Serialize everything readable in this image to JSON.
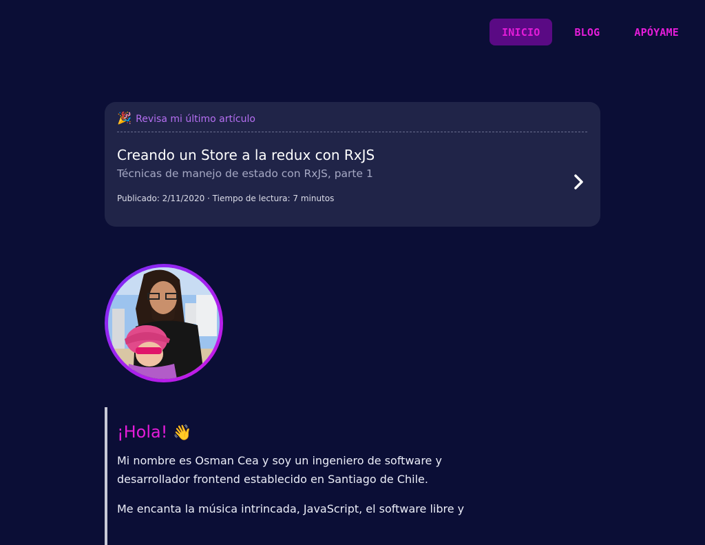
{
  "nav": {
    "items": [
      {
        "label": "INICIO",
        "active": true
      },
      {
        "label": "BLOG",
        "active": false
      },
      {
        "label": "APÓYAME",
        "active": false
      }
    ]
  },
  "latest_post": {
    "heading": "Revisa mi último artículo",
    "title": "Creando un Store a la redux con RxJS",
    "subtitle": "Técnicas de manejo de estado con RxJS, parte 1",
    "meta": "Publicado: 2/11/2020 · Tiempo de lectura: 7 minutos"
  },
  "intro": {
    "greeting": "¡Hola!",
    "wave_emoji": "👋",
    "paragraphs": [
      "Mi nombre es Osman Cea y soy un ingeniero de software y desarrollador frontend establecido en Santiago de Chile.",
      "Me encanta la música intrincada, JavaScript, el software libre y"
    ]
  },
  "colors": {
    "background": "#0b0e36",
    "accent": "#e41cd9",
    "nav_active_bg": "#5a0a84",
    "card_bg": "#202448"
  },
  "icons": {
    "party": "party-popper-icon",
    "chevron": "chevron-right-icon"
  }
}
